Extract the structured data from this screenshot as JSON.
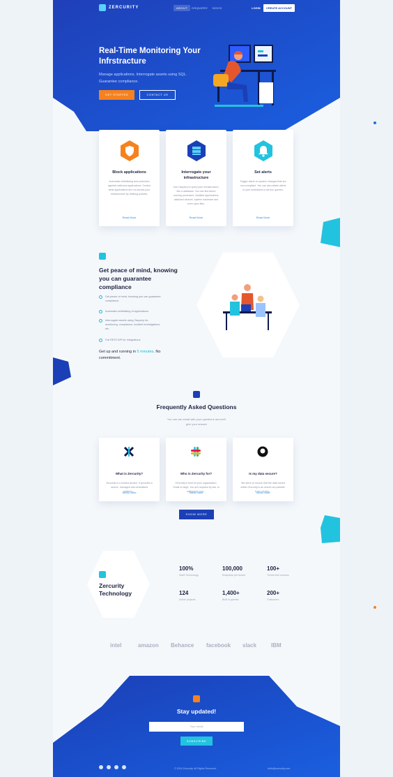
{
  "nav": {
    "brand": "ZERCURITY",
    "links": [
      "ABOUT",
      "OSQUERY",
      "DOCS"
    ],
    "login": "LOGIN",
    "create_account": "CREATE ACCOUNT"
  },
  "hero": {
    "title": "Real-Time Monitoring Your Infrstracture",
    "subtitle": "Manage applications. Interrogate assets using SQL. Guarantee compliance.",
    "cta_primary": "GET STARTED",
    "cta_secondary": "CONTACT US"
  },
  "features": [
    {
      "title": "Block applications",
      "text": "Automatic whitelisting and protection against malicious applications. Control what applications are run across your infrastructure by defining policies.",
      "link": "Read More",
      "icon": "shield-icon"
    },
    {
      "title": "Interrogate your infrastructure",
      "text": "Use Osquery to query your infrastructure, like a database. You can find about running processes, installed applications, attached devices, system hardware and even open files.",
      "link": "Read More",
      "icon": "server-icon"
    },
    {
      "title": "Set alerts",
      "text": "Trigger alerts on system changes that are non-compliant. You can also attach alerts to your scheduled or ad-hoc queries.",
      "link": "Read More",
      "icon": "bell-icon"
    }
  ],
  "peace": {
    "title": "Get peace of mind, knowing you can guarantee compliance",
    "checks": [
      "Get peace of mind, knowing you can guarantee compliance.",
      "Automatic whitelisting of applications.",
      "Interrogate assets using Osquery for, monitoring, compliance, incident investigations etc.",
      "Full REST API for integrations."
    ],
    "getup_prefix": "Get up and running in ",
    "getup_highlight": "5 minutes",
    "getup_suffix": ". No commitment."
  },
  "faq": {
    "title": "Frequently Asked Questions",
    "subtitle": "You can can email with your questions and we'll give your answer",
    "items": [
      {
        "q": "What is Zercurity?",
        "a": "Zercurity is a hosted service. It provides a secure, managed and centralised platform...",
        "link": "Show more"
      },
      {
        "q": "Who is Zercurity for?",
        "a": "Zercurity is built for your organisation. Small or large. You are required by law, to safeguard your...",
        "link": "Show more"
      },
      {
        "q": "Is my data secure?",
        "a": "We strive to ensure that the data stored within Zercurity is as secure as possible. It our priority...",
        "link": "Show more"
      }
    ],
    "show_more": "SHOW MORE"
  },
  "stats": {
    "title": "Zercurity Technology",
    "items": [
      {
        "num": "100%",
        "label": "SaaS Technology"
      },
      {
        "num": "100,000",
        "label": "Endpoints per tenant"
      },
      {
        "num": "100+",
        "label": "Threat intel sources"
      },
      {
        "num": "124",
        "label": "Active projects"
      },
      {
        "num": "1,400+",
        "label": "Built in queries"
      },
      {
        "num": "200+",
        "label": "Customers"
      }
    ]
  },
  "brands": [
    "intel",
    "amazon",
    "Behance",
    "facebook",
    "slack",
    "IBM"
  ],
  "footer": {
    "stay": "Stay updated!",
    "email_placeholder": "Your email",
    "subscribe": "SUBSCRIBE",
    "copyright": "© 2018 Zercurity. All Rights Reserved.",
    "contact": "hello@zercurity.com"
  },
  "colors": {
    "primary": "#1b3fb6",
    "accent": "#f5821f",
    "cyan": "#22c3df"
  }
}
